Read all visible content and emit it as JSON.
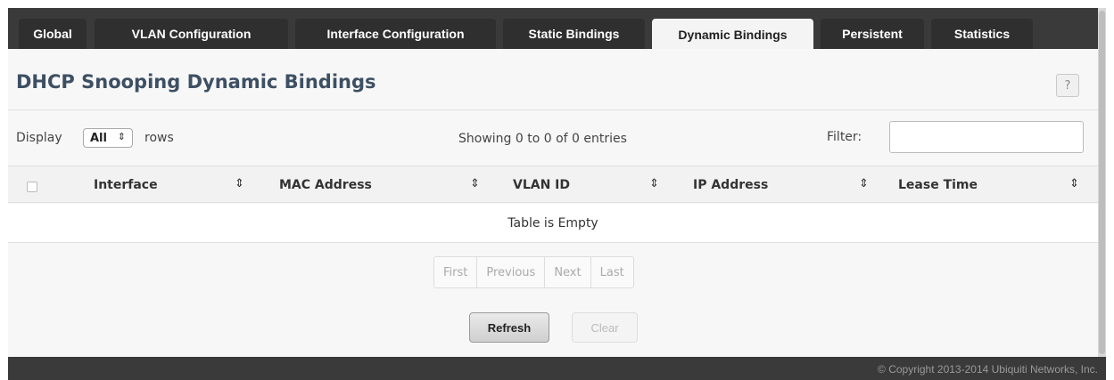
{
  "tabs": [
    {
      "label": "Global",
      "active": false
    },
    {
      "label": "VLAN Configuration",
      "active": false
    },
    {
      "label": "Interface Configuration",
      "active": false
    },
    {
      "label": "Static Bindings",
      "active": false
    },
    {
      "label": "Dynamic Bindings",
      "active": true
    },
    {
      "label": "Persistent",
      "active": false
    },
    {
      "label": "Statistics",
      "active": false
    }
  ],
  "page": {
    "title": "DHCP Snooping Dynamic Bindings",
    "help_label": "?"
  },
  "controls": {
    "display_label": "Display",
    "rows_select_value": "All",
    "rows_label": "rows",
    "showing_text": "Showing 0 to 0 of 0 entries",
    "filter_label": "Filter:",
    "filter_value": ""
  },
  "table": {
    "columns": [
      "Interface",
      "MAC Address",
      "VLAN ID",
      "IP Address",
      "Lease Time"
    ],
    "empty_message": "Table is Empty"
  },
  "pagination": {
    "first": "First",
    "previous": "Previous",
    "next": "Next",
    "last": "Last"
  },
  "buttons": {
    "refresh": "Refresh",
    "clear": "Clear"
  },
  "footer": {
    "copyright": "© Copyright 2013-2014 Ubiquiti Networks, Inc."
  },
  "icons": {
    "sort": "sort-icon",
    "select_arrows": "updown-icon",
    "help": "help-icon"
  },
  "colors": {
    "title": "#3d4f63",
    "frame": "#3a3a3a",
    "panel": "#f7f7f7"
  }
}
